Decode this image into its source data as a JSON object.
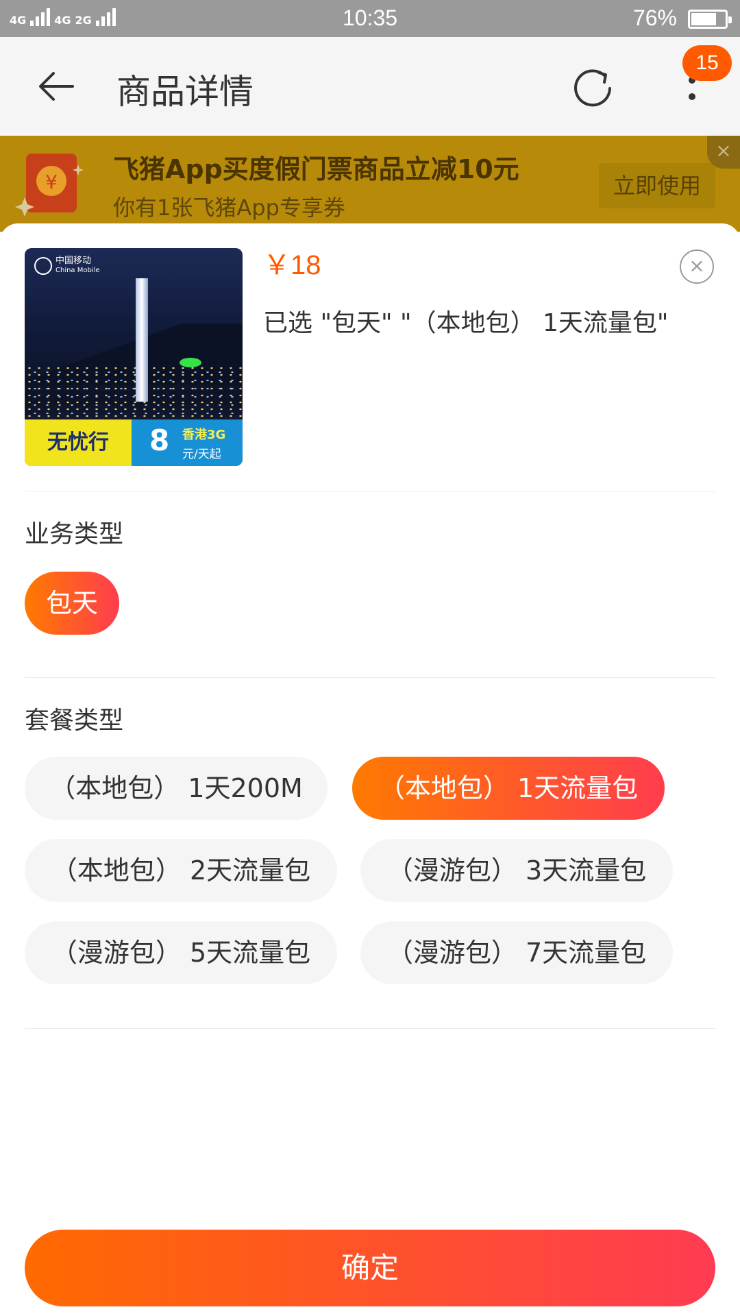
{
  "status_bar": {
    "network_left": "4G",
    "network_mid": "4G",
    "network_right": "2G",
    "time": "10:35",
    "battery_percent": "76%",
    "battery_level": 0.76
  },
  "header": {
    "title": "商品详情",
    "badge_count": "15"
  },
  "promo": {
    "title": "飞猪App买度假门票商品立减10元",
    "subtitle": "你有1张飞猪App专享券",
    "button_label": "立即使用",
    "close_glyph": "×"
  },
  "product": {
    "price": "￥18",
    "selected": "已选 \"包天\" \"（本地包） 1天流量包\"",
    "image": {
      "logo_cn": "中国移动",
      "logo_en": "China Mobile",
      "brand": "无忧行",
      "price_number": "8",
      "region": "香港3G",
      "unit": "元/天起"
    }
  },
  "business_type": {
    "title": "业务类型",
    "options": [
      {
        "label": "包天",
        "selected": true
      }
    ]
  },
  "package_type": {
    "title": "套餐类型",
    "options": [
      {
        "label": "（本地包） 1天200M",
        "selected": false
      },
      {
        "label": "（本地包） 1天流量包",
        "selected": true
      },
      {
        "label": "（本地包） 2天流量包",
        "selected": false
      },
      {
        "label": "（漫游包） 3天流量包",
        "selected": false
      },
      {
        "label": "（漫游包） 5天流量包",
        "selected": false
      },
      {
        "label": "（漫游包） 7天流量包",
        "selected": false
      }
    ]
  },
  "confirm_label": "确定",
  "colors": {
    "accent_start": "#ff7a00",
    "accent_end": "#ff3d4e",
    "price": "#ff5a00",
    "badge": "#ff5a00"
  }
}
